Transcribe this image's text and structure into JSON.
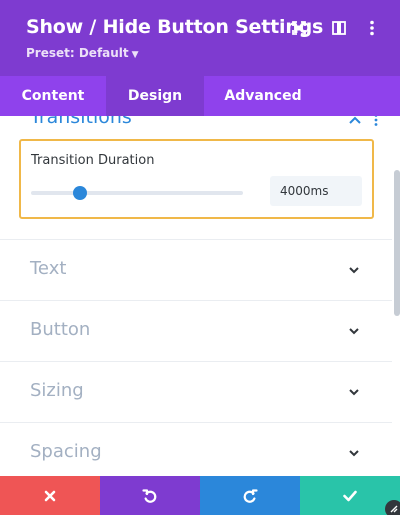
{
  "header": {
    "title": "Show / Hide Button Settings",
    "preset_label": "Preset: Default",
    "icons": [
      "expand-icon",
      "split-view-icon",
      "more-vertical-icon"
    ],
    "background": "#7e3bd0"
  },
  "tabs": [
    {
      "label": "Content",
      "active": false
    },
    {
      "label": "Design",
      "active": true
    },
    {
      "label": "Advanced",
      "active": false
    }
  ],
  "section": {
    "title": "Transitions",
    "transition_duration": {
      "label": "Transition Duration",
      "value": "4000ms",
      "slider_fraction": 0.23
    }
  },
  "toggles": [
    {
      "label": "Text"
    },
    {
      "label": "Button"
    },
    {
      "label": "Sizing"
    },
    {
      "label": "Spacing"
    }
  ],
  "footer": {
    "buttons": [
      {
        "name": "cancel",
        "icon": "close-icon",
        "color": "#ef5555"
      },
      {
        "name": "undo",
        "icon": "undo-icon",
        "color": "#7e3bd0"
      },
      {
        "name": "redo",
        "icon": "redo-icon",
        "color": "#2b87da"
      },
      {
        "name": "save",
        "icon": "check-icon",
        "color": "#29c4a9"
      }
    ]
  },
  "colors": {
    "accent": "#2b87da",
    "focus_border": "#f0b849",
    "tab_bar": "#8f42ec"
  }
}
